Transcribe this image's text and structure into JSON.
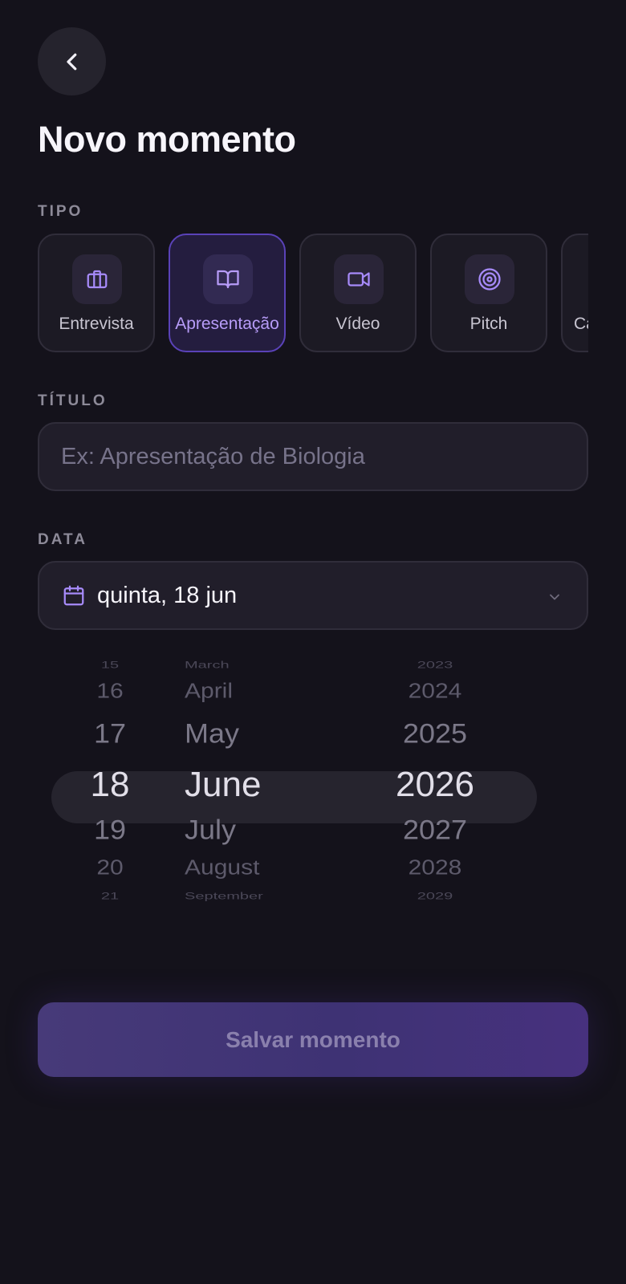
{
  "page": {
    "title": "Novo momento"
  },
  "tipo": {
    "label": "TIPO",
    "options": [
      {
        "label": "Entrevista",
        "icon": "briefcase-icon",
        "selected": false
      },
      {
        "label": "Apresentação",
        "icon": "book-open-icon",
        "selected": true
      },
      {
        "label": "Vídeo",
        "icon": "video-camera-icon",
        "selected": false
      },
      {
        "label": "Pitch",
        "icon": "target-icon",
        "selected": false
      },
      {
        "label": "Ca",
        "icon": "",
        "selected": false
      }
    ]
  },
  "titulo": {
    "label": "TÍTULO",
    "placeholder": "Ex: Apresentação de Biologia",
    "value": ""
  },
  "data": {
    "label": "DATA",
    "value": "quinta, 18 jun"
  },
  "picker": {
    "days": [
      "15",
      "16",
      "17",
      "18",
      "19",
      "20",
      "21"
    ],
    "months": [
      "March",
      "April",
      "May",
      "June",
      "July",
      "August",
      "September"
    ],
    "years": [
      "2023",
      "2024",
      "2025",
      "2026",
      "2027",
      "2028",
      "2029"
    ],
    "selected": {
      "day": "18",
      "month": "June",
      "year": "2026"
    }
  },
  "actions": {
    "save_label": "Salvar momento"
  },
  "colors": {
    "background": "#14121b",
    "accent": "#b79cf8",
    "button": "#473a79"
  }
}
